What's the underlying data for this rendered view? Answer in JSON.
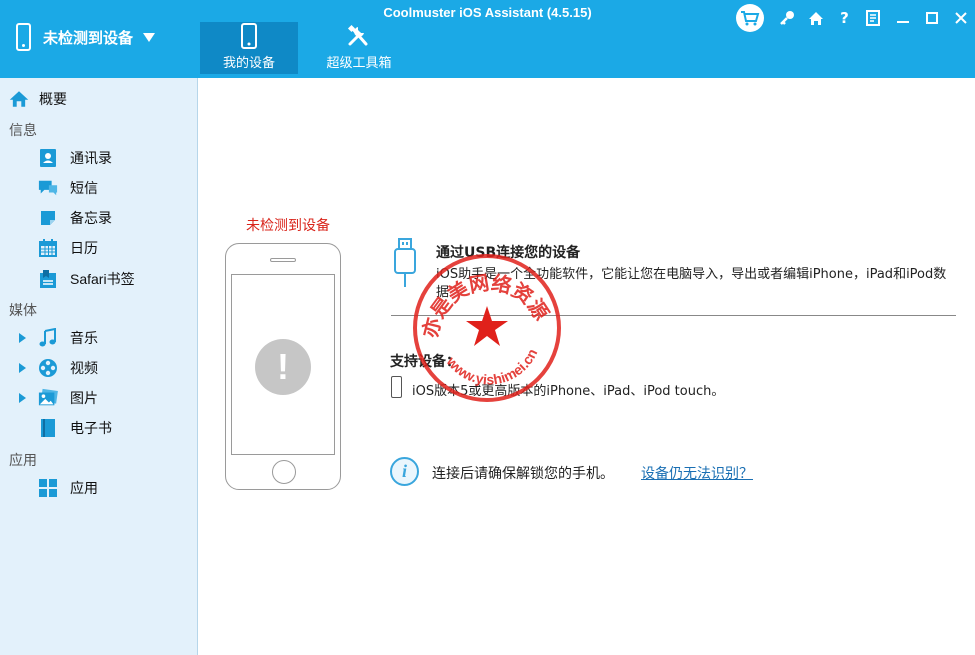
{
  "app": {
    "title": "Coolmuster iOS Assistant (4.5.15)"
  },
  "header": {
    "device_label": "未检测到设备",
    "tabs": [
      {
        "label": "我的设备",
        "active": true
      },
      {
        "label": "超级工具箱",
        "active": false
      }
    ],
    "accent_color": "#1ba9e6"
  },
  "sidebar": {
    "overview": "概要",
    "sections": {
      "info": "信息",
      "media": "媒体",
      "apps": "应用"
    },
    "items": {
      "contacts": "通讯录",
      "sms": "短信",
      "notes": "备忘录",
      "calendar": "日历",
      "safari": "Safari书签",
      "music": "音乐",
      "video": "视频",
      "photos": "图片",
      "ebooks": "电子书",
      "apps": "应用"
    }
  },
  "main": {
    "not_detected": "未检测到设备",
    "usb_title": "通过USB连接您的设备",
    "usb_desc": "iOS助手是一个全功能软件，它能让您在电脑导入，导出或者编辑iPhone，iPad和iPod数据",
    "supported_title": "支持设备：",
    "supported_text": "iOS版本5或更高版本的iPhone、iPad、iPod touch。",
    "info_text": "连接后请确保解锁您的手机。",
    "help_link": "设备仍无法识别？"
  },
  "watermark": {
    "text_top": "亦是美网络资源分享",
    "text_bottom": "www.yishimei.cn",
    "color": "#e0211b"
  }
}
